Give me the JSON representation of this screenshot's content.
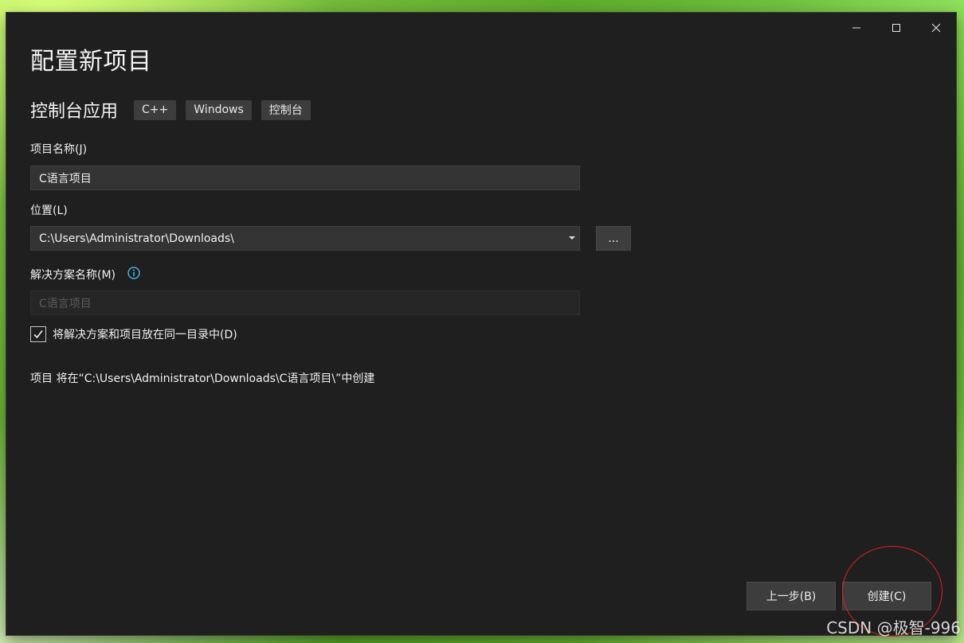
{
  "dialog": {
    "title": "配置新项目",
    "template_name": "控制台应用",
    "tags": [
      "C++",
      "Windows",
      "控制台"
    ]
  },
  "window_controls": {
    "minimize_icon": "minimize-icon",
    "maximize_icon": "maximize-icon",
    "close_icon": "close-icon"
  },
  "project_name": {
    "label": "项目名称(J)",
    "value": "C语言项目"
  },
  "location": {
    "label": "位置(L)",
    "value": "C:\\Users\\Administrator\\Downloads\\",
    "browse_label": "..."
  },
  "solution_name": {
    "label": "解决方案名称(M)",
    "placeholder": "C语言项目",
    "info_icon": "info-icon"
  },
  "same_directory": {
    "label": "将解决方案和项目放在同一目录中(D)",
    "checked": true
  },
  "path_info": "项目 将在“C:\\Users\\Administrator\\Downloads\\C语言项目\\”中创建",
  "footer": {
    "back_label": "上一步(B)",
    "create_label": "创建(C)"
  },
  "colors": {
    "dialog_bg": "#1f1f1f",
    "input_bg": "#333333",
    "button_bg": "#3d3d3d",
    "info_icon": "#4fc3f7",
    "highlight_circle": "#e02020"
  },
  "watermark": "CSDN @极智-996"
}
